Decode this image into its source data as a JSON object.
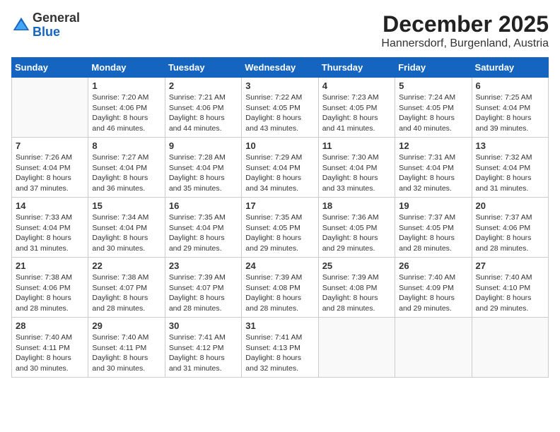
{
  "header": {
    "logo_general": "General",
    "logo_blue": "Blue",
    "month_title": "December 2025",
    "location": "Hannersdorf, Burgenland, Austria"
  },
  "weekdays": [
    "Sunday",
    "Monday",
    "Tuesday",
    "Wednesday",
    "Thursday",
    "Friday",
    "Saturday"
  ],
  "weeks": [
    [
      {
        "day": "",
        "info": ""
      },
      {
        "day": "1",
        "info": "Sunrise: 7:20 AM\nSunset: 4:06 PM\nDaylight: 8 hours\nand 46 minutes."
      },
      {
        "day": "2",
        "info": "Sunrise: 7:21 AM\nSunset: 4:06 PM\nDaylight: 8 hours\nand 44 minutes."
      },
      {
        "day": "3",
        "info": "Sunrise: 7:22 AM\nSunset: 4:05 PM\nDaylight: 8 hours\nand 43 minutes."
      },
      {
        "day": "4",
        "info": "Sunrise: 7:23 AM\nSunset: 4:05 PM\nDaylight: 8 hours\nand 41 minutes."
      },
      {
        "day": "5",
        "info": "Sunrise: 7:24 AM\nSunset: 4:05 PM\nDaylight: 8 hours\nand 40 minutes."
      },
      {
        "day": "6",
        "info": "Sunrise: 7:25 AM\nSunset: 4:04 PM\nDaylight: 8 hours\nand 39 minutes."
      }
    ],
    [
      {
        "day": "7",
        "info": "Sunrise: 7:26 AM\nSunset: 4:04 PM\nDaylight: 8 hours\nand 37 minutes."
      },
      {
        "day": "8",
        "info": "Sunrise: 7:27 AM\nSunset: 4:04 PM\nDaylight: 8 hours\nand 36 minutes."
      },
      {
        "day": "9",
        "info": "Sunrise: 7:28 AM\nSunset: 4:04 PM\nDaylight: 8 hours\nand 35 minutes."
      },
      {
        "day": "10",
        "info": "Sunrise: 7:29 AM\nSunset: 4:04 PM\nDaylight: 8 hours\nand 34 minutes."
      },
      {
        "day": "11",
        "info": "Sunrise: 7:30 AM\nSunset: 4:04 PM\nDaylight: 8 hours\nand 33 minutes."
      },
      {
        "day": "12",
        "info": "Sunrise: 7:31 AM\nSunset: 4:04 PM\nDaylight: 8 hours\nand 32 minutes."
      },
      {
        "day": "13",
        "info": "Sunrise: 7:32 AM\nSunset: 4:04 PM\nDaylight: 8 hours\nand 31 minutes."
      }
    ],
    [
      {
        "day": "14",
        "info": "Sunrise: 7:33 AM\nSunset: 4:04 PM\nDaylight: 8 hours\nand 31 minutes."
      },
      {
        "day": "15",
        "info": "Sunrise: 7:34 AM\nSunset: 4:04 PM\nDaylight: 8 hours\nand 30 minutes."
      },
      {
        "day": "16",
        "info": "Sunrise: 7:35 AM\nSunset: 4:04 PM\nDaylight: 8 hours\nand 29 minutes."
      },
      {
        "day": "17",
        "info": "Sunrise: 7:35 AM\nSunset: 4:05 PM\nDaylight: 8 hours\nand 29 minutes."
      },
      {
        "day": "18",
        "info": "Sunrise: 7:36 AM\nSunset: 4:05 PM\nDaylight: 8 hours\nand 29 minutes."
      },
      {
        "day": "19",
        "info": "Sunrise: 7:37 AM\nSunset: 4:05 PM\nDaylight: 8 hours\nand 28 minutes."
      },
      {
        "day": "20",
        "info": "Sunrise: 7:37 AM\nSunset: 4:06 PM\nDaylight: 8 hours\nand 28 minutes."
      }
    ],
    [
      {
        "day": "21",
        "info": "Sunrise: 7:38 AM\nSunset: 4:06 PM\nDaylight: 8 hours\nand 28 minutes."
      },
      {
        "day": "22",
        "info": "Sunrise: 7:38 AM\nSunset: 4:07 PM\nDaylight: 8 hours\nand 28 minutes."
      },
      {
        "day": "23",
        "info": "Sunrise: 7:39 AM\nSunset: 4:07 PM\nDaylight: 8 hours\nand 28 minutes."
      },
      {
        "day": "24",
        "info": "Sunrise: 7:39 AM\nSunset: 4:08 PM\nDaylight: 8 hours\nand 28 minutes."
      },
      {
        "day": "25",
        "info": "Sunrise: 7:39 AM\nSunset: 4:08 PM\nDaylight: 8 hours\nand 28 minutes."
      },
      {
        "day": "26",
        "info": "Sunrise: 7:40 AM\nSunset: 4:09 PM\nDaylight: 8 hours\nand 29 minutes."
      },
      {
        "day": "27",
        "info": "Sunrise: 7:40 AM\nSunset: 4:10 PM\nDaylight: 8 hours\nand 29 minutes."
      }
    ],
    [
      {
        "day": "28",
        "info": "Sunrise: 7:40 AM\nSunset: 4:11 PM\nDaylight: 8 hours\nand 30 minutes."
      },
      {
        "day": "29",
        "info": "Sunrise: 7:40 AM\nSunset: 4:11 PM\nDaylight: 8 hours\nand 30 minutes."
      },
      {
        "day": "30",
        "info": "Sunrise: 7:41 AM\nSunset: 4:12 PM\nDaylight: 8 hours\nand 31 minutes."
      },
      {
        "day": "31",
        "info": "Sunrise: 7:41 AM\nSunset: 4:13 PM\nDaylight: 8 hours\nand 32 minutes."
      },
      {
        "day": "",
        "info": ""
      },
      {
        "day": "",
        "info": ""
      },
      {
        "day": "",
        "info": ""
      }
    ]
  ]
}
